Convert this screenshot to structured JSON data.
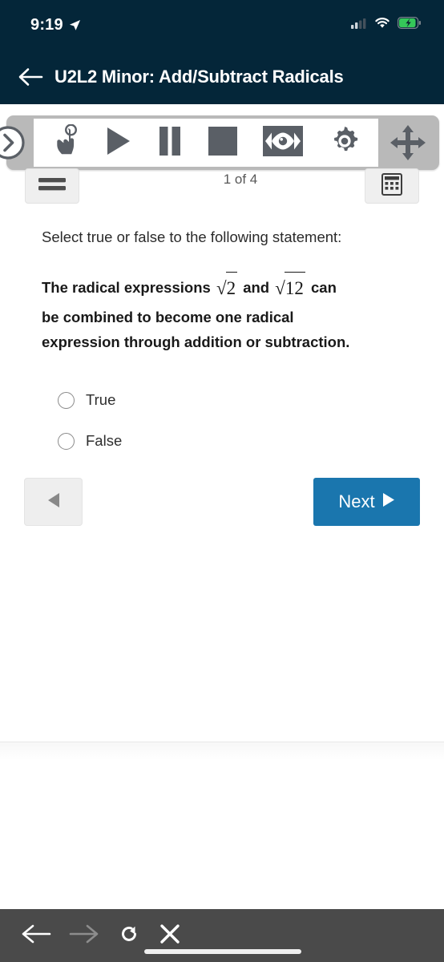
{
  "status_bar": {
    "time": "9:19",
    "location_icon": "location-arrow-icon",
    "signal_icon": "cellular-signal-icon",
    "wifi_icon": "wifi-icon",
    "battery_icon": "battery-charging-icon",
    "battery_color": "#35c759"
  },
  "nav_header": {
    "back_icon": "back-arrow-icon",
    "title": "U2L2 Minor: Add/Subtract Radicals",
    "background_color": "#042639"
  },
  "player_toolbar": {
    "side_toggle_icon": "chevron-right-circle-icon",
    "buttons": [
      {
        "name": "tap-hand-icon",
        "label": "Tap"
      },
      {
        "name": "play-icon",
        "label": "Play"
      },
      {
        "name": "pause-icon",
        "label": "Pause"
      },
      {
        "name": "stop-icon",
        "label": "Stop"
      },
      {
        "name": "closed-caption-eye-icon",
        "label": "Captions"
      },
      {
        "name": "settings-gear-icon",
        "label": "Settings"
      }
    ],
    "move_icon": "move-arrows-icon",
    "menu_icon": "hamburger-menu-icon",
    "calculator_icon": "calculator-icon",
    "page_count": "1 of 4",
    "shell_color": "#b9b9b9",
    "icon_color": "#5a5f66"
  },
  "question": {
    "prompt": "Select true or false to the following statement:",
    "statement_parts": {
      "lead": "The radical expressions",
      "radical_1_index": "√",
      "radical_1_value": "2",
      "conjunction": "and",
      "radical_2_index": "√",
      "radical_2_value": "12",
      "tail": "can be combined to become one radical expression through addition or subtraction."
    },
    "choices": [
      {
        "label": "True",
        "selected": false
      },
      {
        "label": "False",
        "selected": false
      }
    ]
  },
  "navigation": {
    "prev_label": "",
    "prev_icon": "triangle-left-icon",
    "next_label": "Next",
    "next_icon": "triangle-right-icon",
    "next_color": "#1a76ae"
  },
  "browser_bar": {
    "back_icon": "browser-back-arrow-icon",
    "forward_icon": "browser-forward-arrow-icon",
    "reload_icon": "reload-icon",
    "close_icon": "close-x-icon",
    "home_indicator": "home-indicator-bar",
    "background_color": "#4a4a4a"
  }
}
